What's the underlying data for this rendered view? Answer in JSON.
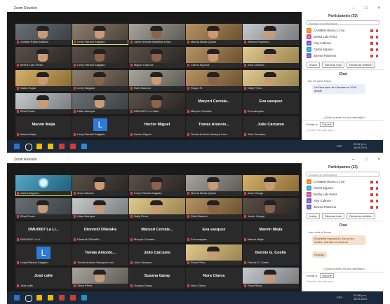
{
  "top": {
    "window": {
      "title": "Zoom Reunión",
      "min": "–",
      "max": "□",
      "close": "×"
    },
    "tiles": [
      {
        "name": "Zoraida Rubio Aldama",
        "video": "p1",
        "face": "head"
      },
      {
        "name": "Lesly Patricia Salgado",
        "video": "p2",
        "face": "head",
        "active": true
      },
      {
        "name": "Javier Antonio Bastidas Uriba",
        "video": "p3",
        "face": "head dark"
      },
      {
        "name": "Marcia Maria Quiroz",
        "video": "p4",
        "face": "head"
      },
      {
        "name": "Jimena Palomino",
        "video": "p5",
        "face": "head"
      },
      {
        "name": "Berthe Lida Pérez",
        "video": "p6",
        "face": "head"
      },
      {
        "name": "Lesly Patricia Salgado",
        "video": "p6",
        "face": "head dark"
      },
      {
        "name": "Miguel Cabrera",
        "video": "p6",
        "face": "head dark"
      },
      {
        "name": "Carlos Elguera",
        "video": "p4",
        "face": "head"
      },
      {
        "name": "Amy Cabrera",
        "video": "p8",
        "face": "head"
      },
      {
        "name": "Nadia Rojas",
        "video": "p7",
        "face": "head"
      },
      {
        "name": "Lesly Salgado",
        "video": "p2",
        "face": "head dark"
      },
      {
        "name": "Ruth Macedo",
        "video": "p3",
        "face": "head"
      },
      {
        "name": "Roque R.",
        "video": "p4",
        "face": "head dark"
      },
      {
        "name": "Nelly Pérez",
        "video": "p8",
        "face": "head"
      },
      {
        "name": "Elisa Flores",
        "video": "p5",
        "face": "head"
      },
      {
        "name": "Lilian Moreyra",
        "video": "p1",
        "face": "head"
      },
      {
        "name": "DMU0007 Lu Lisbet",
        "video": "p6",
        "face": "head dark"
      },
      {
        "name": "Maryori Corrales",
        "video": "",
        "big": "Maryori Corrala..."
      },
      {
        "name": "Eva vasquez",
        "video": "",
        "big": "Eva vasquez"
      },
      {
        "name": "Marvin Mejia",
        "video": "",
        "big": "Marvin Mejía"
      },
      {
        "name": "Lesly Patricia Salgado",
        "video": "",
        "avatar": "L"
      },
      {
        "name": "Hector Miguel",
        "video": "",
        "big": "Hector Miguel"
      },
      {
        "name": "Tomás Antonio Moreyra Lazo",
        "video": "",
        "big": "Tomás Antonio..."
      },
      {
        "name": "Julio Cárcamo",
        "video": "",
        "big": "Julio Cárcamo"
      }
    ],
    "panel": {
      "title": "Participantes (33)",
      "search": "Buscar un participante",
      "participants": [
        {
          "initial": "C",
          "color": "#e8862c",
          "name": "CARMEN Rivera C (Yo)"
        },
        {
          "initial": "B",
          "color": "#d94b8a",
          "name": "Bertha Lida Pérez"
        },
        {
          "initial": "A",
          "color": "#6a5acd",
          "name": "Amy Cabrera"
        },
        {
          "initial": "C",
          "color": "#2aa6c9",
          "name": "Carlos Elguera"
        },
        {
          "initial": "J",
          "color": "#7a5bd8",
          "name": "Jimena Palomino"
        }
      ],
      "buttons": [
        "Invitar",
        "Silenciar todo",
        "Reclamar anfitrión"
      ],
      "chat_title": "Chat",
      "chat_from": "De: Mí para Todos",
      "chat_msg": "Un Resumen de Canales en 2019 donde",
      "notice": "¿Quién puede ver sus mensajes?",
      "send_to": "Enviar a:",
      "send_target": "Todos ▾",
      "type_here": "Escribir mensaje aquí..."
    },
    "clock": {
      "time": "03:52 p.m.",
      "date": "18/11/2021"
    }
  },
  "bottom": {
    "window": {
      "title": "Zoom Reunión",
      "min": "–",
      "max": "□",
      "close": "×"
    },
    "tiles": [
      {
        "name": "Carlos Elguera",
        "video": "p9",
        "active": true,
        "logo": true
      },
      {
        "name": "Amy Cabrera",
        "video": "p6",
        "face": "head"
      },
      {
        "name": "Lesly Patricia Salgado",
        "video": "p6",
        "face": "head dark"
      },
      {
        "name": "Marcia Maria Quiroz",
        "video": "p3",
        "face": "head"
      },
      {
        "name": "Juan Ortega",
        "video": "p7",
        "face": "head"
      },
      {
        "name": "Elisa Flores",
        "video": "p1",
        "face": "head"
      },
      {
        "name": "Lilian Moreyra",
        "video": "p5",
        "face": "head"
      },
      {
        "name": "Nelly Pérez",
        "video": "p8",
        "face": "head"
      },
      {
        "name": "Ruth Macedo",
        "video": "p4",
        "face": "head dark"
      },
      {
        "name": "Javier Ortega",
        "video": "p6",
        "face": "head dark"
      },
      {
        "name": "DMU0007 La Li...",
        "video": "",
        "big": "DMU0007 La Li..."
      },
      {
        "name": "Dioniroll ONelaFa",
        "video": "",
        "big": "Dioniroll ONelaFa"
      },
      {
        "name": "Maryori Corrales",
        "video": "",
        "big": "Maryori Corrale..."
      },
      {
        "name": "Eva vasquez",
        "video": "",
        "big": "Eva vasquez"
      },
      {
        "name": "Marvin Mejia",
        "video": "",
        "big": "Marvin Mejía"
      },
      {
        "name": "Lesly Patricia Salgado",
        "video": "",
        "avatar": "L"
      },
      {
        "name": "Tomás Antonio Moreyra Lazo",
        "video": "",
        "big": "Tomás Antonio..."
      },
      {
        "name": "Julio Cárcamo",
        "video": "",
        "big": "Julio Cárcamo"
      },
      {
        "name": "Sonia Pinto",
        "video": "p8",
        "face": "head"
      },
      {
        "name": "Dennis G. Coello",
        "video": "",
        "big": "Dennis G. Coello"
      },
      {
        "name": "José calle",
        "video": "",
        "big": "José calle"
      },
      {
        "name": "Vilma Pérez",
        "video": "p3",
        "face": "head"
      },
      {
        "name": "Susana Garay",
        "video": "",
        "big": "Susana Garay"
      },
      {
        "name": "Nora Claros",
        "video": "",
        "big": "Nora Claros"
      },
      {
        "name": "Rosa Rivas",
        "video": "p5",
        "face": "head"
      }
    ],
    "panel": {
      "title": "Participantes (33)",
      "search": "Buscar un participante",
      "participants": [
        {
          "initial": "C",
          "color": "#e8862c",
          "name": "CARMEN Rivera C (Yo)"
        },
        {
          "initial": "C",
          "color": "#2aa6c9",
          "name": "Carlos Elguera"
        },
        {
          "initial": "B",
          "color": "#d94b8a",
          "name": "Bertha Lida Pérez"
        },
        {
          "initial": "A",
          "color": "#6a5acd",
          "name": "Amy Cabrera"
        },
        {
          "initial": "J",
          "color": "#7a5bd8",
          "name": "Jimena Palomino"
        }
      ],
      "buttons": [
        "Invitar",
        "Silenciar todo",
        "Reclamar anfitrión"
      ],
      "chat_title": "Chat",
      "chat_from": "Jose calle a Todos",
      "chat_msg": "Excelente exposición. No se les olviden mandar los tesoros.",
      "chat_msg2": "Gracias.",
      "notice": "¿Quién puede ver sus mensajes?",
      "send_to": "Enviar a:",
      "send_target": "Todos ▾",
      "type_here": "Escribir mensaje aquí..."
    },
    "clock": {
      "time": "03:58 p.m.",
      "date": "18/11/2021"
    }
  },
  "taskbar": {
    "lang": "ESP",
    "colors": [
      "#2d6fd1",
      "#e5e5e5",
      "#f5b800",
      "#f5b800",
      "#d33b2e",
      "#d33b2e",
      "#2d8ccf"
    ]
  }
}
